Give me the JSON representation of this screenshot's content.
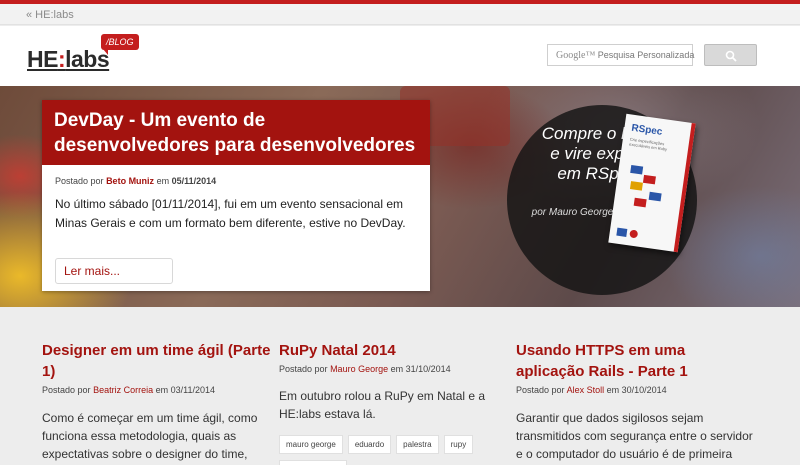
{
  "topbar": {
    "back_link": "« HE:labs"
  },
  "brand": {
    "logo_main": "HE",
    "logo_colon": ":",
    "logo_rest": "labs",
    "blog_tag": "/BLOG"
  },
  "search": {
    "google": "Google™",
    "placeholder": "Pesquisa Personalizada"
  },
  "featured": {
    "title": "DevDay - Um evento de desenvolvedores para desenvolvedores",
    "posted_by_label": "Postado por",
    "author": "Beto Muniz",
    "date_label": "em",
    "date": "05/11/2014",
    "excerpt": "No último sábado [01/11/2014], fui em um evento sensacional em Minas Gerais e com um formato bem diferente, estive no DevDay.",
    "read_more": "Ler mais..."
  },
  "promo": {
    "text": "Compre o livro e vire expert em RSpec",
    "author": "por Mauro George",
    "book_title": "RSpec",
    "book_subtitle": "Crie especificações executáveis em Ruby"
  },
  "posts": [
    {
      "title": "Designer em um time ágil (Parte 1)",
      "posted_by_label": "Postado por",
      "author": "Beatriz Correia",
      "date_label": "em",
      "date": "03/11/2014",
      "excerpt": "Como é começar em um time ágil, como funciona essa metodologia, quais as expectativas sobre o designer do time,"
    },
    {
      "title": "RuPy Natal 2014",
      "posted_by_label": "Postado por",
      "author": "Mauro George",
      "date_label": "em",
      "date": "31/10/2014",
      "excerpt": "Em outubro rolou a RuPy em Natal e a HE:labs estava lá.",
      "tags": [
        "mauro george",
        "eduardo",
        "palestra",
        "rupy"
      ]
    },
    {
      "title": "Usando HTTPS em uma aplicação Rails - Parte 1",
      "posted_by_label": "Postado por",
      "author": "Alex Stoll",
      "date_label": "em",
      "date": "30/10/2014",
      "excerpt": "Garantir que dados sigilosos sejam transmitidos com segurança entre o servidor e o computador do usuário é de primeira"
    }
  ],
  "colors": {
    "brand_red": "#c41e1e",
    "title_red": "#a3130f",
    "background": "#ededed"
  }
}
